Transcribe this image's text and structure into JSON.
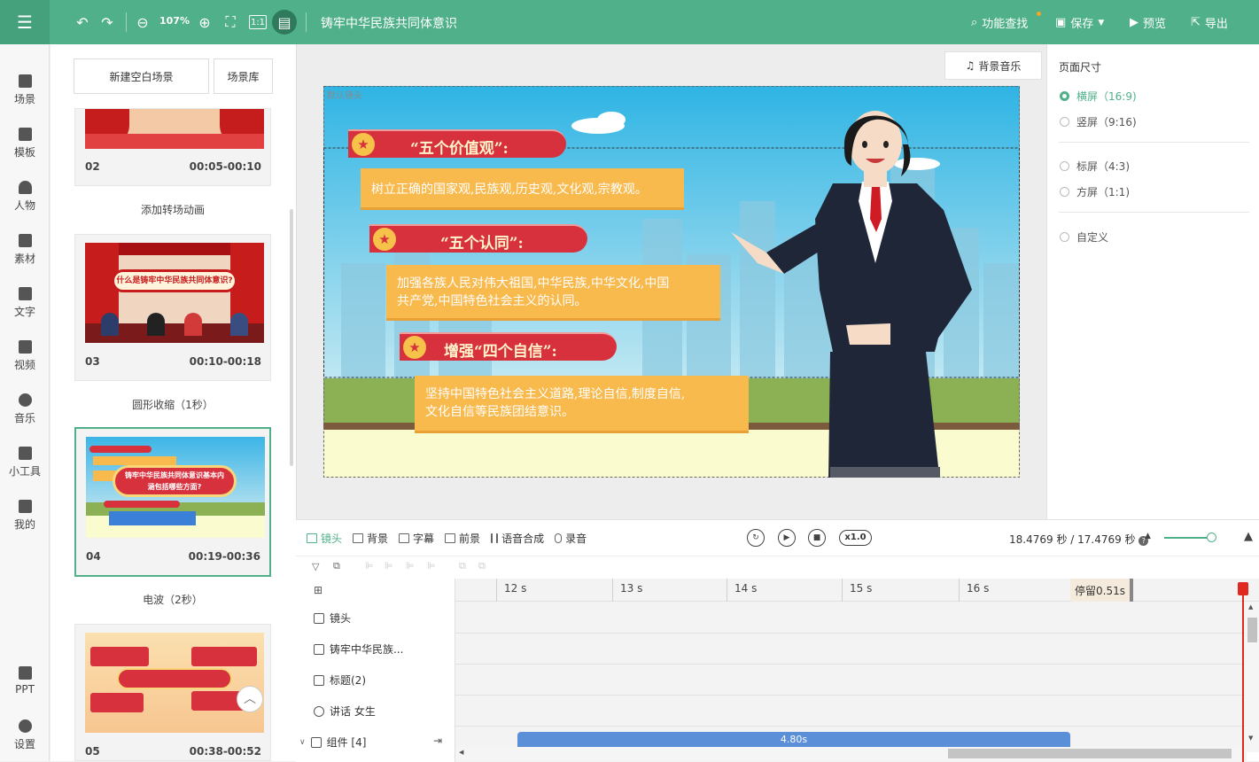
{
  "toolbar": {
    "zoom": "107%",
    "project_title": "铸牢中华民族共同体意识",
    "feature_search": "功能查找",
    "save": "保存",
    "preview": "预览",
    "export": "导出"
  },
  "sidebar": {
    "items": [
      {
        "label": "场景",
        "icon": "scene-icon"
      },
      {
        "label": "模板",
        "icon": "template-icon"
      },
      {
        "label": "人物",
        "icon": "person-icon"
      },
      {
        "label": "素材",
        "icon": "material-icon"
      },
      {
        "label": "文字",
        "icon": "text-icon"
      },
      {
        "label": "视频",
        "icon": "video-icon"
      },
      {
        "label": "音乐",
        "icon": "music-icon"
      },
      {
        "label": "小工具",
        "icon": "toolbox-icon"
      },
      {
        "label": "我的",
        "icon": "upload-icon"
      },
      {
        "label": "PPT",
        "icon": "ppt-icon"
      },
      {
        "label": "设置",
        "icon": "settings-icon"
      }
    ]
  },
  "scene_panel": {
    "new_blank": "新建空白场景",
    "library": "场景库",
    "cards": [
      {
        "num": "02",
        "time": "00:05-00:10",
        "transition": "添加转场动画"
      },
      {
        "num": "03",
        "time": "00:10-00:18",
        "transition": "圆形收缩（1秒）"
      },
      {
        "num": "04",
        "time": "00:19-00:36",
        "transition": "电波（2秒）"
      },
      {
        "num": "05",
        "time": "00:38-00:52"
      }
    ],
    "thumb04_title": "铸牢中华民族共同体意识基本内涵包括哪些方面?",
    "thumb03_banner": "什么是铸牢中华民族共同体意识?"
  },
  "canvas": {
    "bgm_label": "背景音乐",
    "camera_label": "默认镜头",
    "sections": [
      {
        "heading": "“五个价值观”:",
        "body": "树立正确的国家观,民族观,历史观,文化观,宗教观。"
      },
      {
        "heading": "“五个认同”:",
        "body_lines": [
          "加强各族人民对伟大祖国,中华民族,中华文化,中国",
          "共产党,中国特色社会主义的认同。"
        ]
      },
      {
        "heading": "增强“四个自信”:",
        "body_lines": [
          "坚持中国特色社会主义道路,理论自信,制度自信,",
          "文化自信等民族团结意识。"
        ]
      }
    ]
  },
  "right_panel": {
    "title": "页面尺寸",
    "options": [
      {
        "label": "横屏（16:9)",
        "selected": true
      },
      {
        "label": "竖屏（9:16)",
        "selected": false
      },
      {
        "label": "标屏（4:3)",
        "selected": false
      },
      {
        "label": "方屏（1:1)",
        "selected": false
      },
      {
        "label": "自定义",
        "selected": false
      }
    ]
  },
  "timeline": {
    "tabs": [
      "镜头",
      "背景",
      "字幕",
      "前景",
      "语音合成",
      "录音"
    ],
    "speed": "x1.0",
    "duration": "18.4769 秒 / 17.4769 秒",
    "zoom_level": 0.85,
    "ruler": [
      "12 s",
      "13 s",
      "14 s",
      "15 s",
      "16 s"
    ],
    "pause": "停留0.51s",
    "tracks": [
      "镜头",
      "铸牢中华民族...",
      "标题(2)",
      "讲话 女生",
      "组件 [4]"
    ],
    "clip_label": "4.80s"
  },
  "colors": {
    "brand": "#4fb089",
    "banner_red": "#d8313e",
    "text_box_orange": "#f8b94d",
    "clip_blue": "#5b8fd8",
    "playhead": "#e0281f"
  }
}
